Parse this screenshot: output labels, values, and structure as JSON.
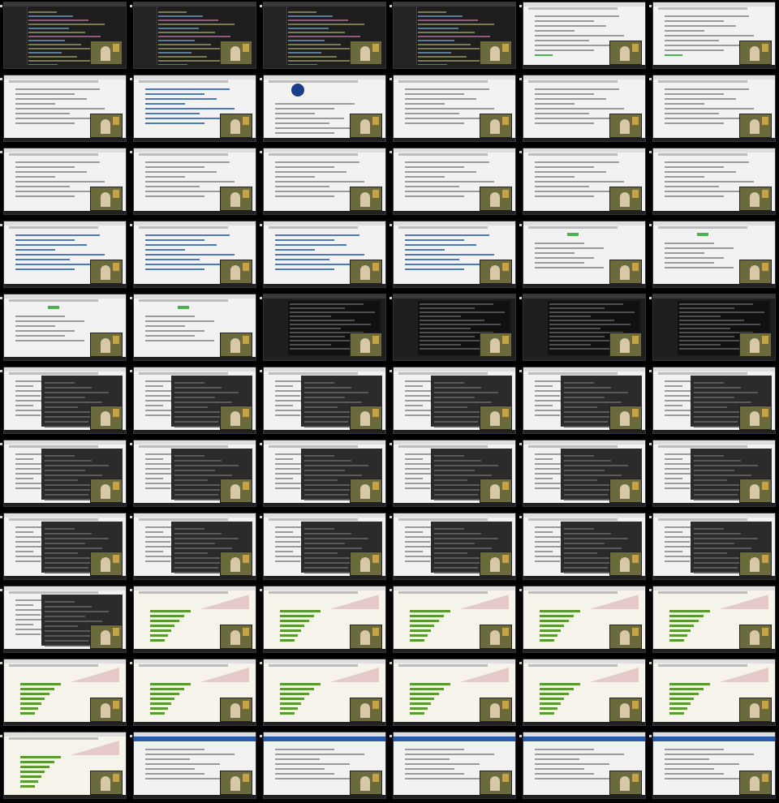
{
  "sheet": {
    "columns": 6,
    "rows": 11,
    "background": "#000000"
  },
  "thumbnails": [
    {
      "kind": "ide"
    },
    {
      "kind": "ide"
    },
    {
      "kind": "ide"
    },
    {
      "kind": "ide"
    },
    {
      "kind": "web-form"
    },
    {
      "kind": "web-form"
    },
    {
      "kind": "profile"
    },
    {
      "kind": "web-table"
    },
    {
      "kind": "doc-logo"
    },
    {
      "kind": "doc"
    },
    {
      "kind": "doc"
    },
    {
      "kind": "doc"
    },
    {
      "kind": "doc"
    },
    {
      "kind": "doc"
    },
    {
      "kind": "doc"
    },
    {
      "kind": "doc"
    },
    {
      "kind": "web-article"
    },
    {
      "kind": "web-article"
    },
    {
      "kind": "code-listing"
    },
    {
      "kind": "code-listing"
    },
    {
      "kind": "code-listing"
    },
    {
      "kind": "code-listing"
    },
    {
      "kind": "ci-page"
    },
    {
      "kind": "ci-page"
    },
    {
      "kind": "ci-page"
    },
    {
      "kind": "ci-page"
    },
    {
      "kind": "terminal"
    },
    {
      "kind": "terminal"
    },
    {
      "kind": "terminal"
    },
    {
      "kind": "terminal"
    },
    {
      "kind": "split-terminal"
    },
    {
      "kind": "split-terminal"
    },
    {
      "kind": "split-terminal"
    },
    {
      "kind": "split-terminal"
    },
    {
      "kind": "split-terminal"
    },
    {
      "kind": "split-terminal"
    },
    {
      "kind": "split-terminal"
    },
    {
      "kind": "split-terminal"
    },
    {
      "kind": "split-terminal"
    },
    {
      "kind": "split-terminal"
    },
    {
      "kind": "split-terminal"
    },
    {
      "kind": "split-terminal"
    },
    {
      "kind": "split-terminal"
    },
    {
      "kind": "split-terminal"
    },
    {
      "kind": "split-terminal"
    },
    {
      "kind": "split-terminal"
    },
    {
      "kind": "split-terminal"
    },
    {
      "kind": "split-terminal"
    },
    {
      "kind": "split-terminal"
    },
    {
      "kind": "dashboard"
    },
    {
      "kind": "dashboard"
    },
    {
      "kind": "dashboard"
    },
    {
      "kind": "dashboard"
    },
    {
      "kind": "dashboard"
    },
    {
      "kind": "dashboard"
    },
    {
      "kind": "dashboard"
    },
    {
      "kind": "dashboard"
    },
    {
      "kind": "dashboard"
    },
    {
      "kind": "dashboard"
    },
    {
      "kind": "dashboard"
    },
    {
      "kind": "dashboard"
    },
    {
      "kind": "issue-tracker"
    },
    {
      "kind": "issue-tracker"
    },
    {
      "kind": "issue-tracker"
    },
    {
      "kind": "issue-tracker"
    },
    {
      "kind": "issue-tracker"
    }
  ],
  "colors": {
    "ide_bg": "#1e1e1e",
    "light_bg": "#f2f2f2",
    "accent_green": "#4caf50",
    "accent_blue": "#2a5aa8",
    "logo_blue": "#1a3d8a",
    "webcam_bg": "#6b6a3c"
  }
}
